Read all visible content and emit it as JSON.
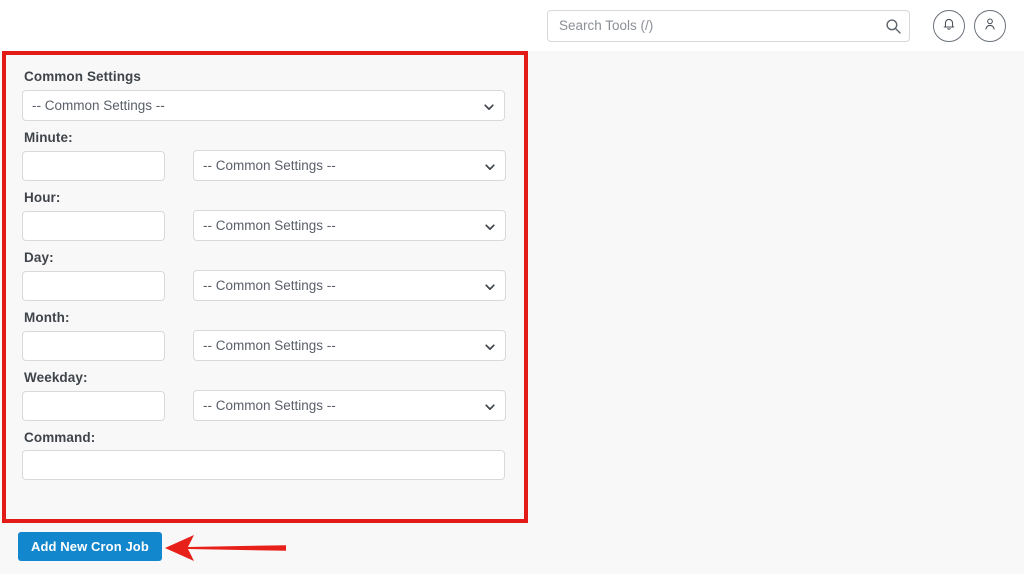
{
  "header": {
    "search": {
      "placeholder": "Search Tools (/)",
      "value": ""
    },
    "notifications_icon": "bell-icon",
    "account_icon": "user-icon",
    "search_icon": "search-icon"
  },
  "panel": {
    "title": "Common Settings",
    "common_settings_select": {
      "selected": "-- Common Settings --"
    },
    "fields": [
      {
        "label": "Minute:",
        "value": "",
        "select_selected": "-- Common Settings --"
      },
      {
        "label": "Hour:",
        "value": "",
        "select_selected": "-- Common Settings --"
      },
      {
        "label": "Day:",
        "value": "",
        "select_selected": "-- Common Settings --"
      },
      {
        "label": "Month:",
        "value": "",
        "select_selected": "-- Common Settings --"
      },
      {
        "label": "Weekday:",
        "value": "",
        "select_selected": "-- Common Settings --"
      }
    ],
    "command": {
      "label": "Command:",
      "value": ""
    },
    "highlight_color": "#e31b16"
  },
  "actions": {
    "submit_label": "Add New Cron Job",
    "submit_color": "#1287cd",
    "annotation_arrow": {
      "name": "annotation-arrow-left",
      "color": "#e8201a"
    }
  },
  "colors": {
    "page_background": "#f8f8f8",
    "header_background": "#ffffff",
    "input_border": "#d7d9dc",
    "text_dark": "#3f444b",
    "text_muted": "#5a6069"
  }
}
